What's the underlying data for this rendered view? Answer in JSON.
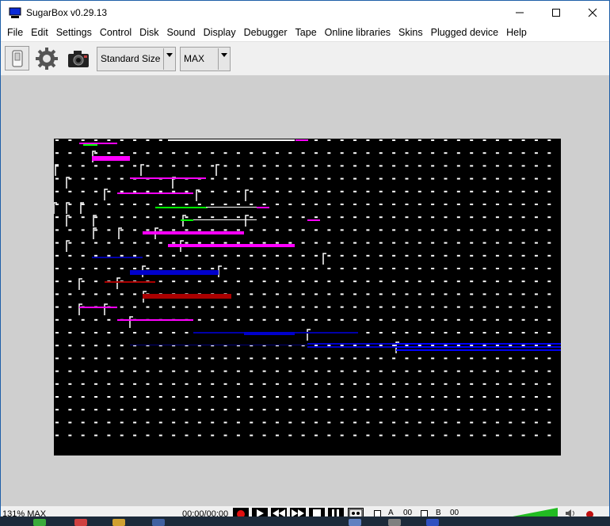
{
  "window": {
    "title": "SugarBox v0.29.13",
    "controls": {
      "minimize": "—",
      "maximize": "☐",
      "close": "✕"
    }
  },
  "menu": [
    "File",
    "Edit",
    "Settings",
    "Control",
    "Disk",
    "Sound",
    "Display",
    "Debugger",
    "Tape",
    "Online libraries",
    "Skins",
    "Plugged device",
    "Help"
  ],
  "toolbar": {
    "power_icon": "power-switch-icon",
    "settings_icon": "gear-icon",
    "snapshot_icon": "camera-icon",
    "size_select": {
      "value": "Standard Size"
    },
    "zoom_select": {
      "value": "MAX"
    }
  },
  "emulator": {
    "background_color": "#cfcfcf",
    "screen_color": "#000000"
  },
  "statusbar": {
    "zoom": "131% MAX",
    "tape_time": "00:00/00:00",
    "tape_buttons": [
      "record",
      "play",
      "rewind",
      "fast-forward",
      "stop",
      "pause",
      "tape-icon"
    ],
    "drive_a_label": "A",
    "drive_a_track": "00",
    "drive_b_label": "B",
    "drive_b_track": "00",
    "volume_color": "#22bb22"
  }
}
